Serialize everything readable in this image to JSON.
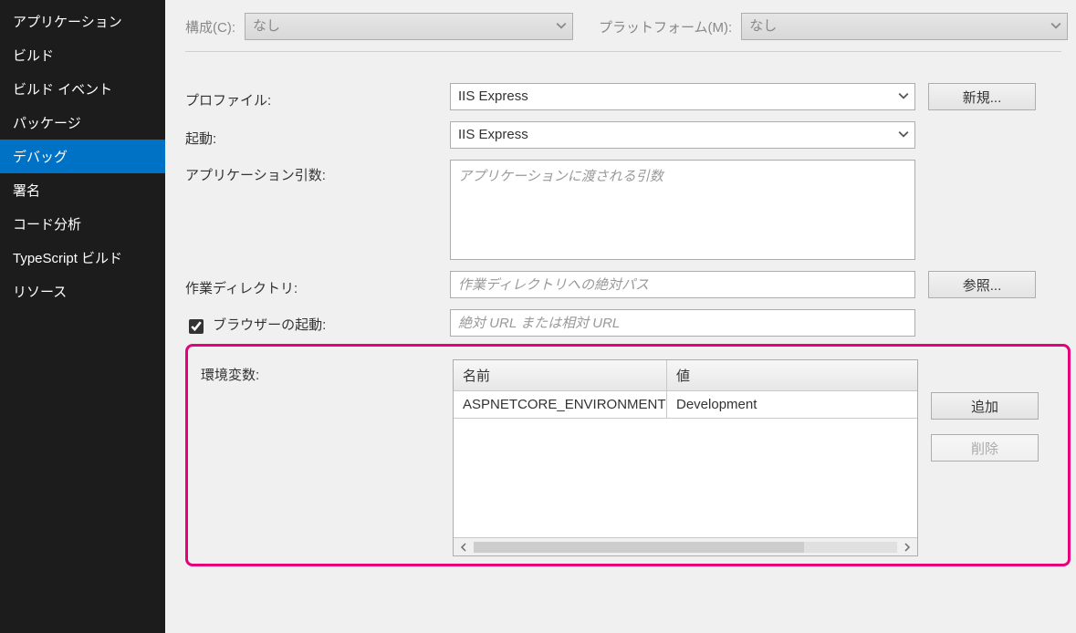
{
  "sidebar": {
    "items": [
      {
        "label": "アプリケーション"
      },
      {
        "label": "ビルド"
      },
      {
        "label": "ビルド イベント"
      },
      {
        "label": "パッケージ"
      },
      {
        "label": "デバッグ"
      },
      {
        "label": "署名"
      },
      {
        "label": "コード分析"
      },
      {
        "label": "TypeScript ビルド"
      },
      {
        "label": "リソース"
      }
    ],
    "active_index": 4
  },
  "topbar": {
    "config_label": "構成(C):",
    "config_value": "なし",
    "platform_label": "プラットフォーム(M):",
    "platform_value": "なし"
  },
  "form": {
    "profile_label": "プロファイル:",
    "profile_value": "IIS Express",
    "new_button": "新規...",
    "launch_label": "起動:",
    "launch_value": "IIS Express",
    "app_args_label": "アプリケーション引数:",
    "app_args_placeholder": "アプリケーションに渡される引数",
    "workdir_label": "作業ディレクトリ:",
    "workdir_placeholder": "作業ディレクトリへの絶対パス",
    "browse_button": "参照...",
    "launch_browser_label": "ブラウザーの起動:",
    "launch_browser_placeholder": "絶対 URL または相対 URL",
    "launch_browser_checked": true,
    "env_label": "環境変数:",
    "env_header_name": "名前",
    "env_header_value": "値",
    "env_rows": [
      {
        "name": "ASPNETCORE_ENVIRONMENT",
        "value": "Development"
      }
    ],
    "add_button": "追加",
    "remove_button": "削除"
  }
}
